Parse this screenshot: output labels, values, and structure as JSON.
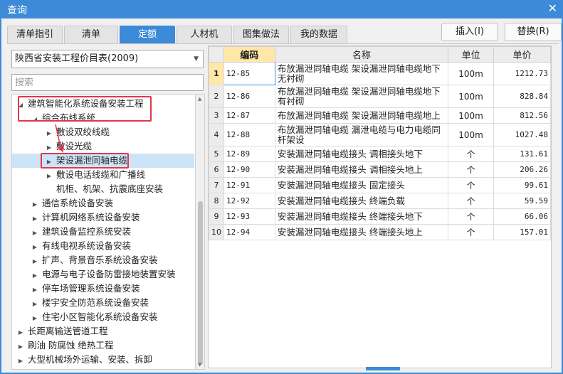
{
  "window": {
    "title": "查询",
    "close_icon": "close-icon"
  },
  "tabs": [
    {
      "label": "清单指引",
      "active": false
    },
    {
      "label": "清单",
      "active": false
    },
    {
      "label": "定额",
      "active": true
    },
    {
      "label": "人材机",
      "active": false
    },
    {
      "label": "图集做法",
      "active": false
    },
    {
      "label": "我的数据",
      "active": false
    }
  ],
  "buttons": {
    "insert": "插入(I)",
    "replace": "替换(R)"
  },
  "library": {
    "selected": "陕西省安装工程价目表(2009)"
  },
  "search": {
    "placeholder": "搜索"
  },
  "tree": [
    "建筑智能化系统设备安装工程",
    "综合布线系统",
    "敷设双绞线缆",
    "敷设光缆",
    "架设漏泄同轴电缆",
    "敷设电话线缆和广播线",
    "机柜、机架、抗震底座安装",
    "通信系统设备安装",
    "计算机网络系统设备安装",
    "建筑设备监控系统安装",
    "有线电视系统设备安装",
    "扩声、背景音乐系统设备安装",
    "电源与电子设备防雷接地装置安装",
    "停车场管理系统设备安装",
    "楼宇安全防范系统设备安装",
    "住宅小区智能化系统设备安装",
    "长距离输送管道工程",
    "刷油 防腐蚀 绝热工程",
    "大型机械场外运输、安装、拆卸"
  ],
  "table": {
    "headers": [
      "编码",
      "名称",
      "单位",
      "单价"
    ],
    "rows": [
      {
        "idx": "1",
        "code": "12-85",
        "name": "布放漏泄同轴电缆 架设漏泄同轴电缆地下无衬砌",
        "unit": "100m",
        "price": "1212.73"
      },
      {
        "idx": "2",
        "code": "12-86",
        "name": "布放漏泄同轴电缆 架设漏泄同轴电缆地下有衬砌",
        "unit": "100m",
        "price": "828.84"
      },
      {
        "idx": "3",
        "code": "12-87",
        "name": "布放漏泄同轴电缆 架设漏泄同轴电缆地上",
        "unit": "100m",
        "price": "812.56"
      },
      {
        "idx": "4",
        "code": "12-88",
        "name": "布放漏泄同轴电缆 漏泄电缆与电力电缆同杆架设",
        "unit": "100m",
        "price": "1027.48"
      },
      {
        "idx": "5",
        "code": "12-89",
        "name": "安装漏泄同轴电缆接头 调相接头地下",
        "unit": "个",
        "price": "131.61"
      },
      {
        "idx": "6",
        "code": "12-90",
        "name": "安装漏泄同轴电缆接头 调相接头地上",
        "unit": "个",
        "price": "206.26"
      },
      {
        "idx": "7",
        "code": "12-91",
        "name": "安装漏泄同轴电缆接头 固定接头",
        "unit": "个",
        "price": "99.61"
      },
      {
        "idx": "8",
        "code": "12-92",
        "name": "安装漏泄同轴电缆接头 终端负载",
        "unit": "个",
        "price": "59.59"
      },
      {
        "idx": "9",
        "code": "12-93",
        "name": "安装漏泄同轴电缆接头 终端接头地下",
        "unit": "个",
        "price": "66.06"
      },
      {
        "idx": "10",
        "code": "12-94",
        "name": "安装漏泄同轴电缆接头 终端接头地上",
        "unit": "个",
        "price": "157.01"
      }
    ]
  },
  "colors": {
    "accent": "#3c8ad8",
    "highlight": "#e8334a",
    "selected_row": "#cce4f7",
    "code_header": "#ffe7a8"
  }
}
